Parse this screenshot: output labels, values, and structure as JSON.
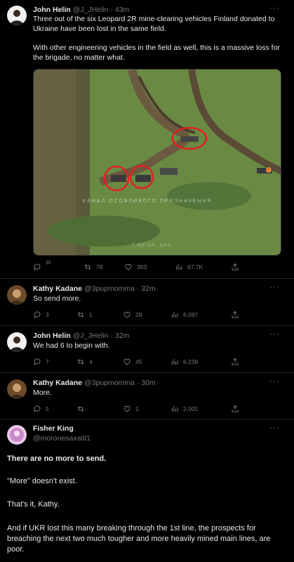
{
  "tweets": [
    {
      "name": "John Helin",
      "handle": "@J_JHelin · 43m",
      "text1": "Three out of the six Leopard 2R mine-clearing vehicles Finland donated to Ukraine have been lost in the same field.",
      "text2": "With other engineering vehicles in the field as well, this is a massive loss for the brigade, no matter what.",
      "photo_watermark1": "КАНАЛ ОСОБЛИВОГО ПРИЗНАЧЕННЯ",
      "photo_watermark2": "T.ME/OR_SPN",
      "stats": {
        "replies": "35",
        "retweets": "78",
        "likes": "393",
        "views": "67.7K"
      }
    },
    {
      "name": "Kathy Kadane",
      "handle": "@3pupmomma · 32m",
      "text": "So send more.",
      "stats": {
        "replies": "3",
        "retweets": "1",
        "likes": "28",
        "views": "6,087"
      }
    },
    {
      "name": "John Helin",
      "handle": "@J_JHelin · 32m",
      "text": "We had 6 to begin with.",
      "stats": {
        "replies": "7",
        "retweets": "4",
        "likes": "45",
        "views": "6,239"
      }
    },
    {
      "name": "Kathy Kadane",
      "handle": "@3pupmomma · 30m",
      "text": "More.",
      "stats": {
        "replies": "5",
        "retweets": "",
        "likes": "1",
        "views": "2,001"
      }
    }
  ],
  "fisher": {
    "name": "Fisher King",
    "handle": "@moronesaxatil1",
    "p1": "There are no more to send.",
    "p2": "\"More\" doesn't exist.",
    "p3": "That's it, Kathy.",
    "p4": "And if UKR lost this many breaking through the 1st line, the prospects for breaching the next two much tougher and more heavily mined main lines, are poor."
  },
  "more_icon": "···",
  "colors": {
    "bg": "#000000",
    "text": "#e7e9ea",
    "muted": "#71767b",
    "circle": "#e02020"
  }
}
